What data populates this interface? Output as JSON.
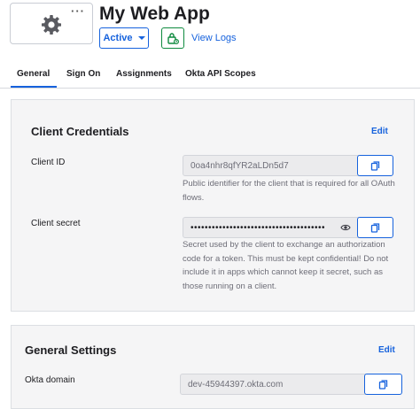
{
  "app": {
    "title": "My Web App",
    "status_label": "Active",
    "view_logs_label": "View Logs"
  },
  "tabs": [
    {
      "label": "General",
      "active": true
    },
    {
      "label": "Sign On",
      "active": false
    },
    {
      "label": "Assignments",
      "active": false
    },
    {
      "label": "Okta API Scopes",
      "active": false
    }
  ],
  "client_credentials": {
    "title": "Client Credentials",
    "edit_label": "Edit",
    "client_id": {
      "label": "Client ID",
      "value": "0oa4nhr8qfYR2aLDn5d7",
      "help": "Public identifier for the client that is required for all OAuth flows."
    },
    "client_secret": {
      "label": "Client secret",
      "value": "••••••••••••••••••••••••••••••••••••••",
      "help": "Secret used by the client to exchange an authorization code for a token. This must be kept confidential! Do not include it in apps which cannot keep it secret, such as those running on a client."
    }
  },
  "general_settings": {
    "title": "General Settings",
    "edit_label": "Edit",
    "okta_domain": {
      "label": "Okta domain",
      "value": "dev-45944397.okta.com"
    }
  },
  "colors": {
    "accent": "#1662dd",
    "success": "#0e8a3e",
    "panel_bg": "#f5f5f6"
  },
  "icons": {
    "app_logo": "gear-icon",
    "app_menu": "more-dots-icon",
    "status_caret": "chevron-down-icon",
    "logs": "lock-log-icon",
    "copy": "copy-icon",
    "reveal": "eye-icon"
  }
}
